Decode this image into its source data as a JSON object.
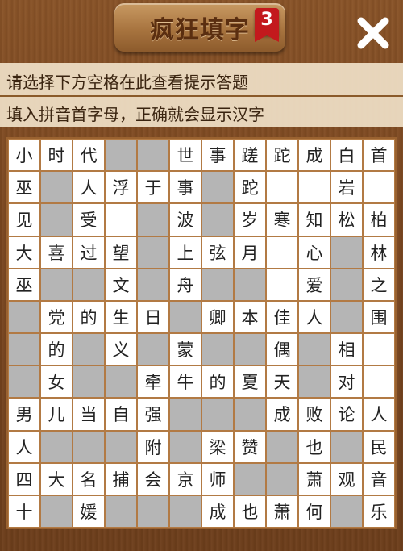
{
  "header": {
    "title": "疯狂填字",
    "level_badge": "3",
    "close_icon": "close-x-icon"
  },
  "hint": {
    "line1": "请选择下方空格在此查看提示答题",
    "line2": "填入拼音首字母，正确就会显示汉字"
  },
  "grid": {
    "rows": [
      [
        "小",
        "时",
        "代",
        "#",
        "#",
        "世",
        "事",
        "蹉",
        "跎",
        "成",
        "白",
        "首"
      ],
      [
        "巫",
        "#",
        "人",
        "浮",
        "于",
        "事",
        "#",
        "跎",
        "",
        "",
        "岩",
        ""
      ],
      [
        "见",
        "#",
        "受",
        "",
        "#",
        "波",
        "#",
        "岁",
        "寒",
        "知",
        "松",
        "柏"
      ],
      [
        "大",
        "喜",
        "过",
        "望",
        "#",
        "上",
        "弦",
        "月",
        "",
        "心",
        "#",
        "林"
      ],
      [
        "巫",
        "#",
        "#",
        "文",
        "#",
        "舟",
        "#",
        "#",
        "",
        "爱",
        "#",
        "之"
      ],
      [
        "#",
        "党",
        "的",
        "生",
        "日",
        "#",
        "卿",
        "本",
        "佳",
        "人",
        "#",
        "围"
      ],
      [
        "#",
        "的",
        "#",
        "义",
        "#",
        "蒙",
        "#",
        "#",
        "偶",
        "#",
        "相",
        ""
      ],
      [
        "#",
        "女",
        "#",
        "#",
        "牵",
        "牛",
        "的",
        "夏",
        "天",
        "#",
        "对",
        ""
      ],
      [
        "男",
        "儿",
        "当",
        "自",
        "强",
        "#",
        "#",
        "#",
        "成",
        "败",
        "论",
        "人"
      ],
      [
        "人",
        "#",
        "#",
        "#",
        "附",
        "#",
        "梁",
        "赞",
        "#",
        "也",
        "#",
        "民"
      ],
      [
        "四",
        "大",
        "名",
        "捕",
        "会",
        "京",
        "师",
        "#",
        "#",
        "萧",
        "观",
        "音"
      ],
      [
        "十",
        "#",
        "媛",
        "#",
        "#",
        "#",
        "成",
        "也",
        "萧",
        "何",
        "#",
        "乐"
      ]
    ]
  },
  "colors": {
    "white_cell": "#ffffff",
    "gray_cell": "#b5b5b5",
    "wood": "#7b4720",
    "badge": "#c3191d"
  }
}
